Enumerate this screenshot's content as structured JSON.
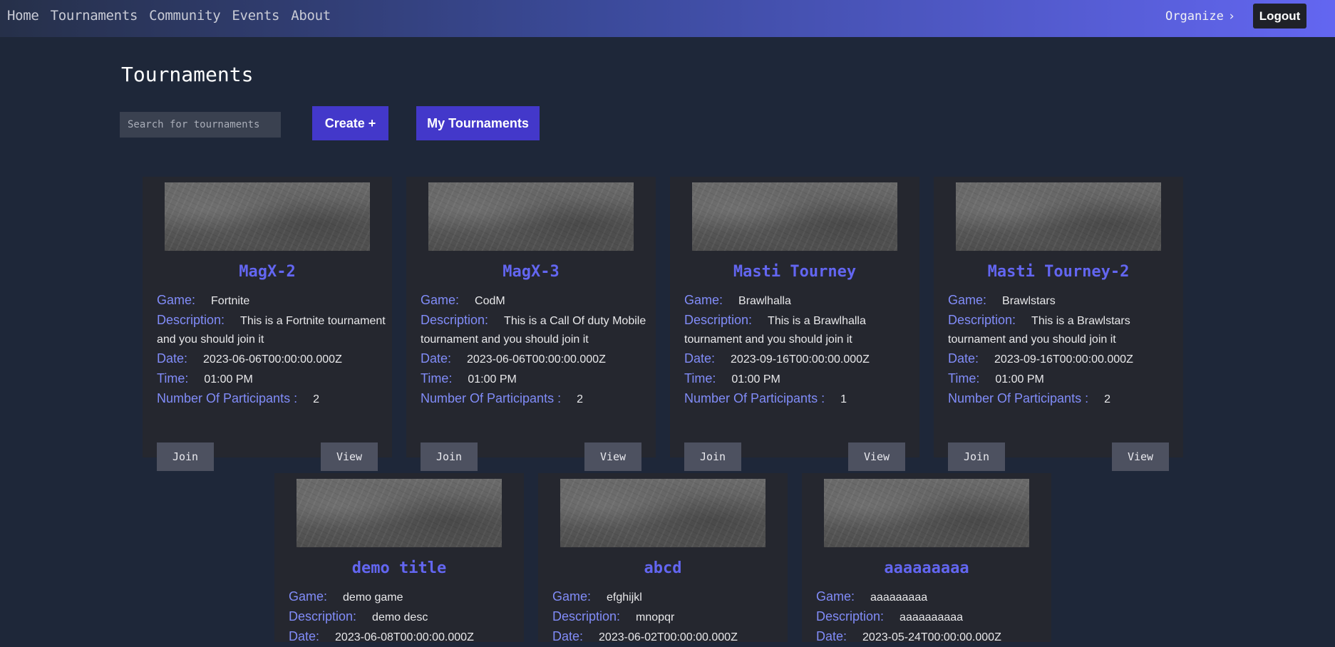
{
  "nav": {
    "links": [
      "Home",
      "Tournaments",
      "Community",
      "Events",
      "About"
    ],
    "organize": "Organize",
    "logout": "Logout"
  },
  "page": {
    "title": "Tournaments",
    "search_placeholder": "Search for tournaments",
    "create_label": "Create +",
    "my_tournaments_label": "My Tournaments"
  },
  "labels": {
    "game": "Game:",
    "description": "Description:",
    "date": "Date:",
    "time": "Time:",
    "participants": "Number Of Participants :",
    "join": "Join",
    "view": "View"
  },
  "cards": [
    {
      "title": "MagX-2",
      "game": "Fortnite",
      "description": "This is a Fortnite tournament and you should join it",
      "date": "2023-06-06T00:00:00.000Z",
      "time": "01:00 PM",
      "participants": "2"
    },
    {
      "title": "MagX-3",
      "game": "CodM",
      "description": "This is a Call Of duty Mobile tournament and you should join it",
      "date": "2023-06-06T00:00:00.000Z",
      "time": "01:00 PM",
      "participants": "2"
    },
    {
      "title": "Masti Tourney",
      "game": "Brawlhalla",
      "description": "This is a Brawlhalla tournament and you should join it",
      "date": "2023-09-16T00:00:00.000Z",
      "time": "01:00 PM",
      "participants": "1"
    },
    {
      "title": "Masti Tourney-2",
      "game": "Brawlstars",
      "description": "This is a Brawlstars tournament and you should join it",
      "date": "2023-09-16T00:00:00.000Z",
      "time": "01:00 PM",
      "participants": "2"
    },
    {
      "title": "demo title",
      "game": "demo game",
      "description": "demo desc",
      "date": "2023-06-08T00:00:00.000Z"
    },
    {
      "title": "abcd",
      "game": "efghijkl",
      "description": "mnopqr",
      "date": "2023-06-02T00:00:00.000Z"
    },
    {
      "title": "aaaaaaaaa",
      "game": "aaaaaaaaa",
      "description": "aaaaaaaaaa",
      "date": "2023-05-24T00:00:00.000Z"
    }
  ],
  "colors": {
    "background": "#1e2739",
    "card": "#25272f",
    "accent": "#6366f1",
    "label": "#818cf8",
    "primary_button": "#4338ca"
  }
}
